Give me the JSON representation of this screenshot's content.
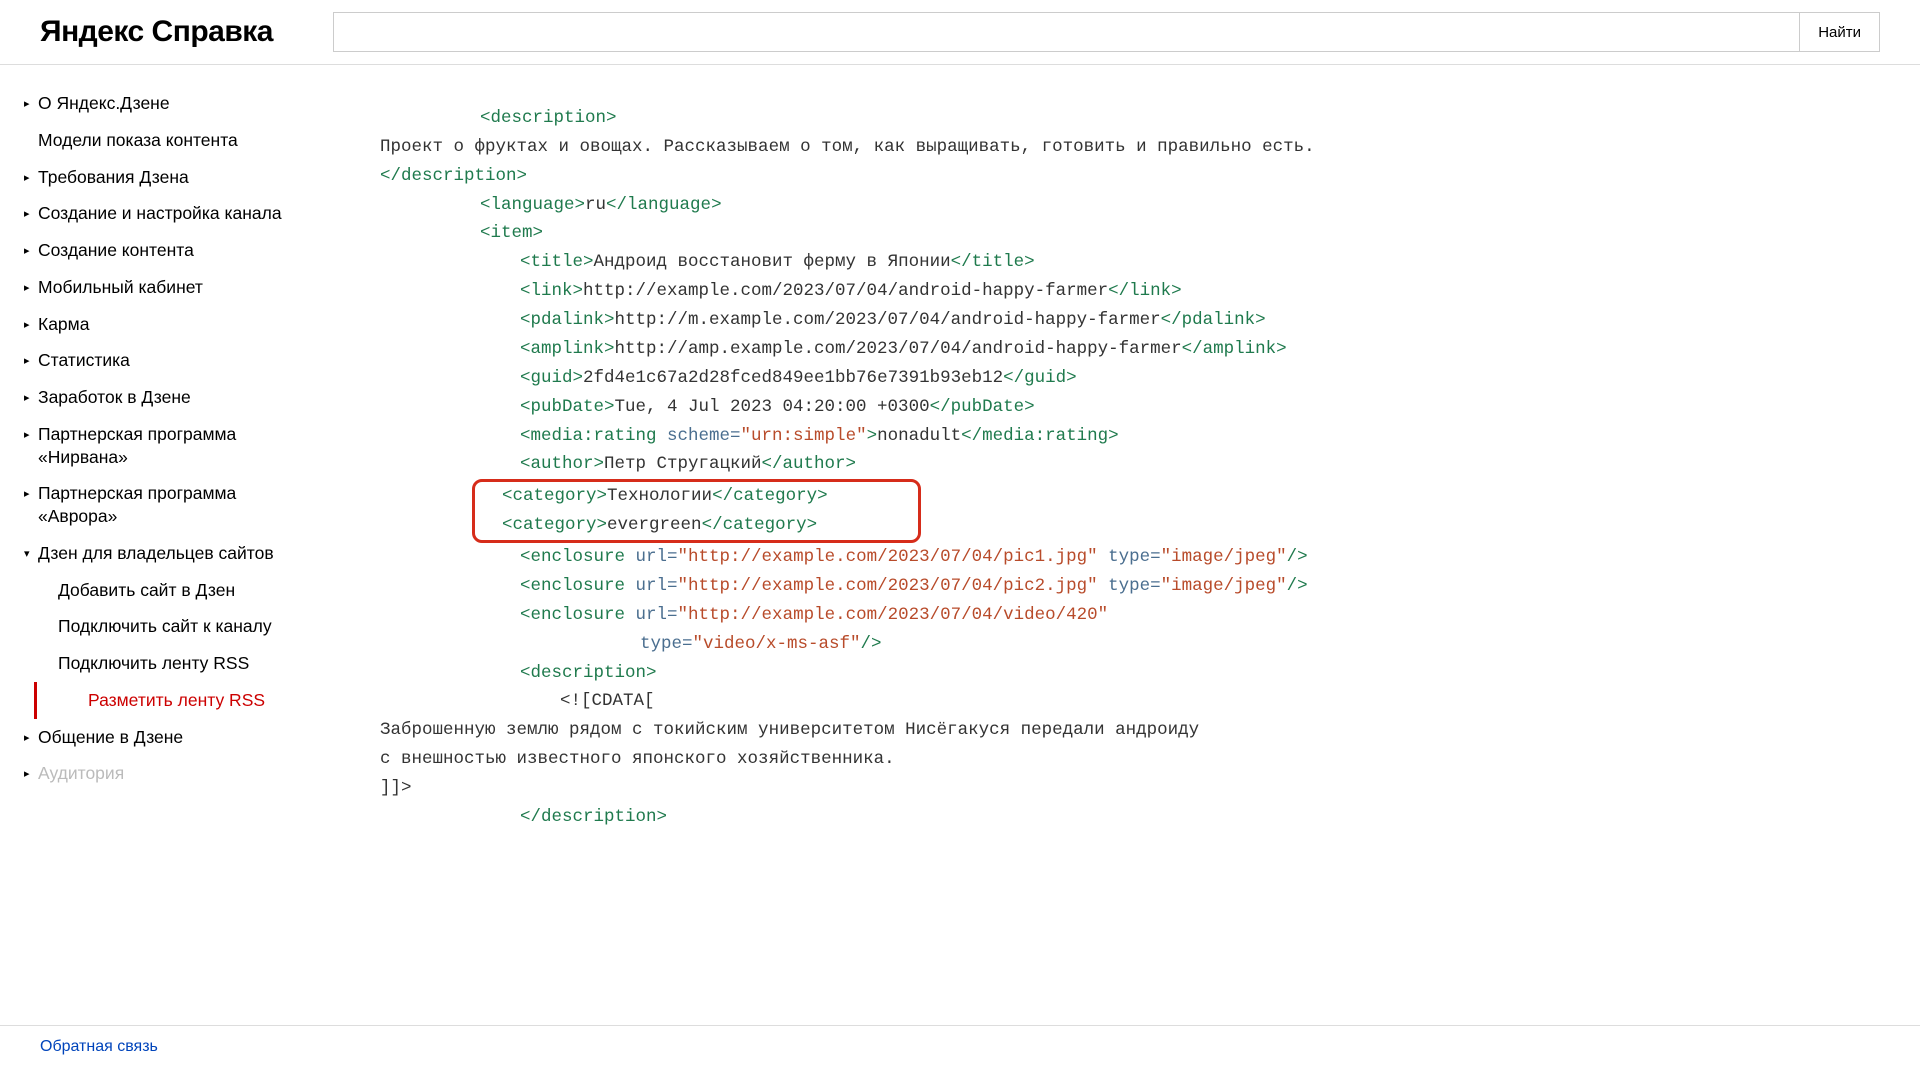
{
  "header": {
    "logo": "Яндекс Справка",
    "search_btn": "Найти"
  },
  "sidebar": {
    "items": [
      {
        "label": "О Яндекс.Дзене",
        "arrow": "▸"
      },
      {
        "label": "Модели показа контента",
        "arrow": ""
      },
      {
        "label": "Требования Дзена",
        "arrow": "▸"
      },
      {
        "label": "Создание и настройка канала",
        "arrow": "▸"
      },
      {
        "label": "Создание контента",
        "arrow": "▸"
      },
      {
        "label": "Мобильный кабинет",
        "arrow": "▸"
      },
      {
        "label": "Карма",
        "arrow": "▸"
      },
      {
        "label": "Статистика",
        "arrow": "▸"
      },
      {
        "label": "Заработок в Дзене",
        "arrow": "▸"
      },
      {
        "label": "Партнерская программа «Нирвана»",
        "arrow": "▸"
      },
      {
        "label": "Партнерская программа «Аврора»",
        "arrow": "▸"
      },
      {
        "label": "Дзен для владельцев сайтов",
        "arrow": "▾",
        "expanded": true,
        "children": [
          {
            "label": "Добавить сайт в Дзен"
          },
          {
            "label": "Подключить сайт к каналу"
          },
          {
            "label": "Подключить ленту RSS"
          },
          {
            "label": "Разметить ленту RSS",
            "active": true
          }
        ]
      },
      {
        "label": "Общение в Дзене",
        "arrow": "▸"
      },
      {
        "label": "Аудитория",
        "arrow": "▸",
        "faded": true
      }
    ]
  },
  "code": {
    "desc_open": "<description>",
    "desc_text": "Проект о фруктах и овощах. Рассказываем о том, как выращивать, готовить и правильно есть.",
    "desc_close": "</description>",
    "lang_open": "<language>",
    "lang_val": "ru",
    "lang_close": "</language>",
    "item_open": "<item>",
    "title_open": "<title>",
    "title_val": "Андроид восстановит ферму в Японии",
    "title_close": "</title>",
    "link_open": "<link>",
    "link_val": "http://example.com/2023/07/04/android-happy-farmer",
    "link_close": "</link>",
    "pdalink_open": "<pdalink>",
    "pdalink_val": "http://m.example.com/2023/07/04/android-happy-farmer",
    "pdalink_close": "</pdalink>",
    "amplink_open": "<amplink>",
    "amplink_val": "http://amp.example.com/2023/07/04/android-happy-farmer",
    "amplink_close": "</amplink>",
    "guid_open": "<guid>",
    "guid_val": "2fd4e1c67a2d28fced849ee1bb76e7391b93eb12",
    "guid_close": "</guid>",
    "pub_open": "<pubDate>",
    "pub_val": "Tue, 4 Jul 2023 04:20:00 +0300",
    "pub_close": "</pubDate>",
    "media_open": "<media:rating ",
    "media_attr": "scheme=",
    "media_str": "\"urn:simple\"",
    "media_gt": ">",
    "media_val": "nonadult",
    "media_close": "</media:rating>",
    "author_open": "<author>",
    "author_val": "Петр Стругацкий",
    "author_close": "</author>",
    "cat1_open": "<category>",
    "cat1_val": "Технологии",
    "cat1_close": "</category>",
    "cat2_open": "<category>",
    "cat2_val": "evergreen",
    "cat2_close": "</category>",
    "enc1_open": "<enclosure ",
    "enc1_url_a": "url=",
    "enc1_url_v": "\"http://example.com/2023/07/04/pic1.jpg\"",
    "enc1_type_a": " type=",
    "enc1_type_v": "\"image/jpeg\"",
    "enc1_close": "/>",
    "enc2_open": "<enclosure ",
    "enc2_url_a": "url=",
    "enc2_url_v": "\"http://example.com/2023/07/04/pic2.jpg\"",
    "enc2_type_a": " type=",
    "enc2_type_v": "\"image/jpeg\"",
    "enc2_close": "/>",
    "enc3_open": "<enclosure ",
    "enc3_url_a": "url=",
    "enc3_url_v": "\"http://example.com/2023/07/04/video/420\"",
    "enc3_type_a": "type=",
    "enc3_type_v": "\"video/x-ms-asf\"",
    "enc3_close": "/>",
    "desc2_open": "<description>",
    "cdata_open": "<![CDATA[",
    "cdata1": "Заброшенную землю рядом с токийским университетом Нисёгакуся передали андроиду",
    "cdata2": "с внешностью известного японского хозяйственника.",
    "cdata_close": "]]>",
    "desc2_close": "</description>"
  },
  "footer": {
    "feedback": "Обратная связь"
  }
}
